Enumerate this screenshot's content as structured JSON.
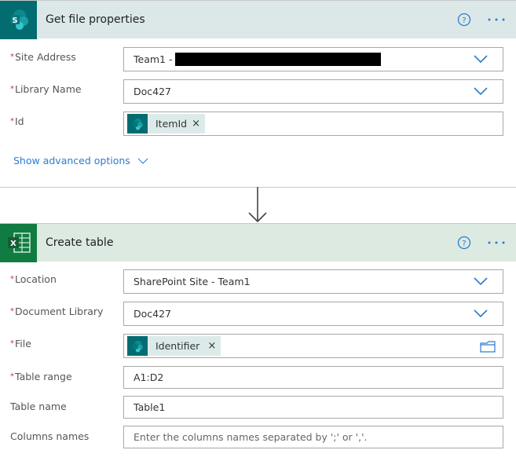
{
  "colors": {
    "sharepoint_brand": "#036c70",
    "sharepoint_header_bg": "#dce8e8",
    "excel_brand": "#107c41",
    "excel_header_bg": "#dceae2",
    "accent": "#2b7cd3",
    "required": "#d13438"
  },
  "card1": {
    "icon": "sharepoint-icon",
    "title": "Get file properties",
    "help_icon": "help-circle-icon",
    "more_icon": "more-ellipsis-icon",
    "fields": [
      {
        "label": "Site Address",
        "required": true,
        "value": "Team1 -",
        "redacted": true,
        "control": "dropdown"
      },
      {
        "label": "Library Name",
        "required": true,
        "value": "Doc427",
        "control": "dropdown"
      },
      {
        "label": "Id",
        "required": true,
        "token": "ItemId",
        "control": "token"
      }
    ],
    "advanced_link": "Show advanced options"
  },
  "card2": {
    "icon": "excel-icon",
    "title": "Create table",
    "help_icon": "help-circle-icon",
    "more_icon": "more-ellipsis-icon",
    "fields": [
      {
        "label": "Location",
        "required": true,
        "value": "SharePoint Site - Team1",
        "control": "dropdown"
      },
      {
        "label": "Document Library",
        "required": true,
        "value": "Doc427",
        "control": "dropdown"
      },
      {
        "label": "File",
        "required": true,
        "token": "Identifier",
        "control": "file-picker"
      },
      {
        "label": "Table range",
        "required": true,
        "value": "A1:D2",
        "control": "text"
      },
      {
        "label": "Table name",
        "required": false,
        "value": "Table1",
        "control": "text"
      },
      {
        "label": "Columns names",
        "required": false,
        "value": "",
        "placeholder": "Enter the columns names separated by ';' or ','.",
        "control": "text"
      }
    ]
  },
  "required_marker": "*",
  "token_remove": "×"
}
